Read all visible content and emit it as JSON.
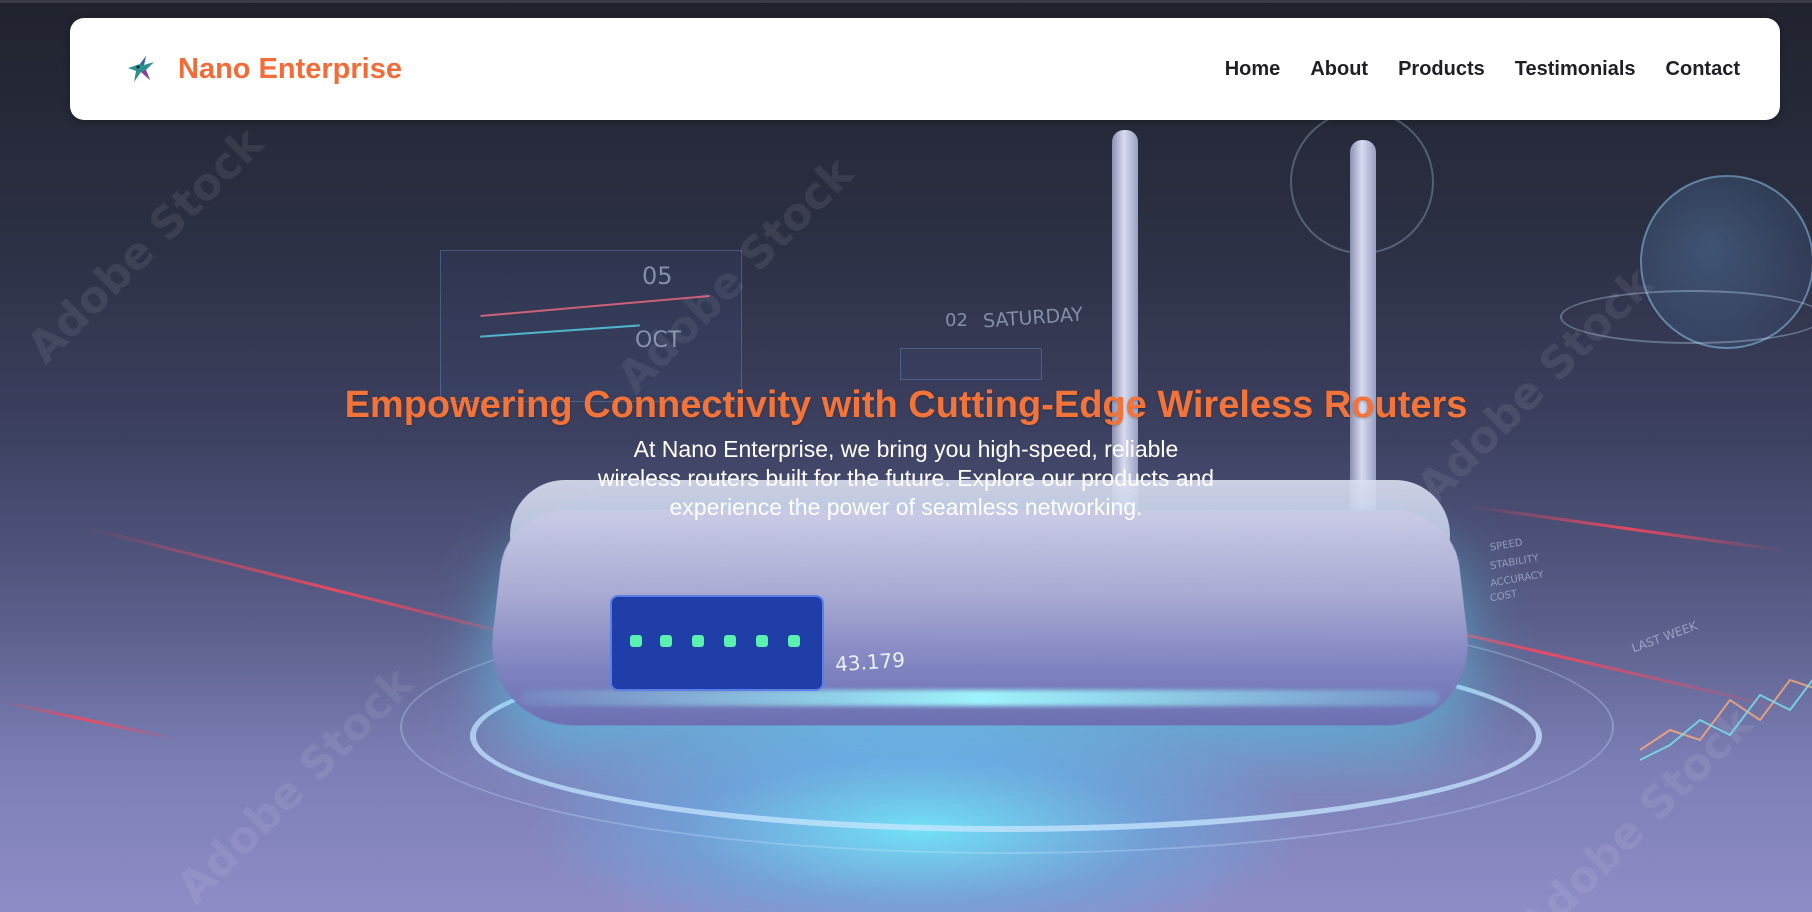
{
  "navbar": {
    "brand_name": "Nano Enterprise",
    "logo_icon": "hummingbird-logo-icon",
    "links": [
      {
        "label": "Home"
      },
      {
        "label": "About"
      },
      {
        "label": "Products"
      },
      {
        "label": "Testimonials"
      },
      {
        "label": "Contact"
      }
    ]
  },
  "hero": {
    "title": "Empowering Connectivity with Cutting-Edge Wireless Routers",
    "subtitle": "At Nano Enterprise, we bring you high-speed, reliable wireless routers built for the future. Explore our products and experience the power of seamless networking.",
    "background_image": {
      "readout_date_day": "05",
      "readout_date_month": "OCT",
      "readout_weekday_num": "02",
      "readout_weekday": "SATURDAY",
      "readout_value": "43.179",
      "readout_week": "LAST WEEK",
      "legend_items": [
        "SPEED",
        "STABILITY",
        "ACCURACY",
        "COST"
      ],
      "watermark": "Adobe Stock"
    }
  },
  "colors": {
    "brand_accent": "#f26b38",
    "title_color": "#f47338",
    "nav_text": "#1f1f24",
    "navbar_bg": "#ffffff"
  }
}
